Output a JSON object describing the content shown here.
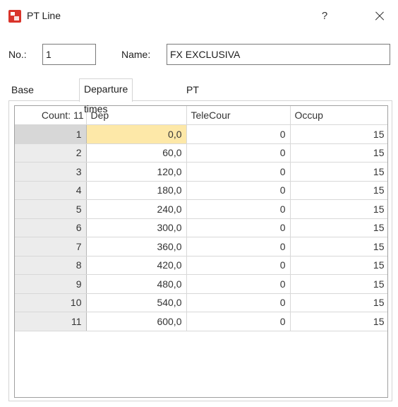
{
  "window": {
    "title": "PT Line",
    "help_label": "?"
  },
  "form": {
    "no_label": "No.:",
    "no_value": "1",
    "name_label": "Name:",
    "name_value": "FX EXCLUSIVA"
  },
  "tabs": [
    {
      "label": "Base data",
      "active": false
    },
    {
      "label": "Departure times",
      "active": true
    },
    {
      "label": "PT telegrams",
      "active": false
    }
  ],
  "grid": {
    "headers": [
      "Count: 11",
      "Dep",
      "TeleCour",
      "Occup"
    ],
    "selected_row": 1,
    "selected_col": "Dep",
    "rows": [
      {
        "n": "1",
        "dep": "0,0",
        "tele": "0",
        "occup": "15"
      },
      {
        "n": "2",
        "dep": "60,0",
        "tele": "0",
        "occup": "15"
      },
      {
        "n": "3",
        "dep": "120,0",
        "tele": "0",
        "occup": "15"
      },
      {
        "n": "4",
        "dep": "180,0",
        "tele": "0",
        "occup": "15"
      },
      {
        "n": "5",
        "dep": "240,0",
        "tele": "0",
        "occup": "15"
      },
      {
        "n": "6",
        "dep": "300,0",
        "tele": "0",
        "occup": "15"
      },
      {
        "n": "7",
        "dep": "360,0",
        "tele": "0",
        "occup": "15"
      },
      {
        "n": "8",
        "dep": "420,0",
        "tele": "0",
        "occup": "15"
      },
      {
        "n": "9",
        "dep": "480,0",
        "tele": "0",
        "occup": "15"
      },
      {
        "n": "10",
        "dep": "540,0",
        "tele": "0",
        "occup": "15"
      },
      {
        "n": "11",
        "dep": "600,0",
        "tele": "0",
        "occup": "15"
      }
    ]
  },
  "colors": {
    "app_icon": "#d9342b",
    "selected_cell": "#fde8a8",
    "row_header": "#ececec"
  }
}
